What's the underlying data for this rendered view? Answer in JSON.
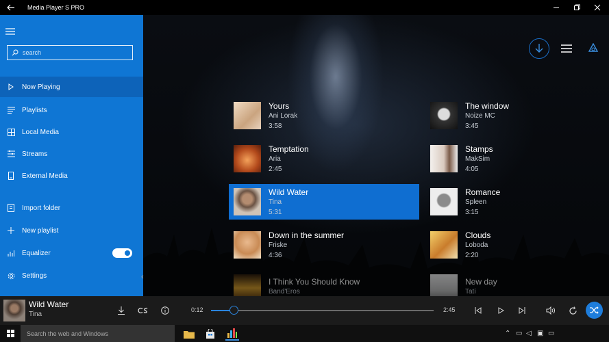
{
  "window": {
    "title": "Media Player S PRO",
    "back_icon": "arrow-left-icon",
    "minimize_icon": "minimize-icon",
    "restore_icon": "restore-icon",
    "close_icon": "close-icon"
  },
  "sidebar": {
    "search_placeholder": "search",
    "items": [
      {
        "label": "Now Playing",
        "icon": "play-outline-icon",
        "active": true
      },
      {
        "label": "Playlists",
        "icon": "playlist-icon"
      },
      {
        "label": "Local Media",
        "icon": "grid-icon"
      },
      {
        "label": "Streams",
        "icon": "streams-icon"
      },
      {
        "label": "External Media",
        "icon": "external-drive-icon"
      },
      {
        "label": "Import folder",
        "icon": "import-folder-icon"
      },
      {
        "label": "New playlist",
        "icon": "plus-icon"
      },
      {
        "label": "Equalizer",
        "icon": "equalizer-icon"
      },
      {
        "label": "Settings",
        "icon": "gear-icon"
      }
    ],
    "equalizer_on": true
  },
  "tracks": [
    {
      "title": "Yours",
      "artist": "Ani Lorak",
      "duration": "3:58"
    },
    {
      "title": "The window",
      "artist": "Noize MC",
      "duration": "3:45"
    },
    {
      "title": "Temptation",
      "artist": "Aria",
      "duration": "2:45"
    },
    {
      "title": "Stamps",
      "artist": "MakSim",
      "duration": "4:05"
    },
    {
      "title": "Wild Water",
      "artist": "Tina",
      "duration": "5:31",
      "selected": true
    },
    {
      "title": "Romance",
      "artist": "Spleen",
      "duration": "3:15"
    },
    {
      "title": "Down in the summer",
      "artist": "Friske",
      "duration": "4:36"
    },
    {
      "title": "Clouds",
      "artist": "Loboda",
      "duration": "2:20"
    },
    {
      "title": "I Think You Should Know",
      "artist": "Band'Eros",
      "duration": ""
    },
    {
      "title": "New day",
      "artist": "Tati",
      "duration": ""
    }
  ],
  "now_playing": {
    "title": "Wild Water",
    "artist": "Tina",
    "elapsed": "0:12",
    "total": "2:45",
    "progress": 0.1
  },
  "taskbar": {
    "search_placeholder": "Search the web and Windows"
  },
  "colors": {
    "accent": "#0f76d4",
    "selected": "#0f6ed1"
  }
}
